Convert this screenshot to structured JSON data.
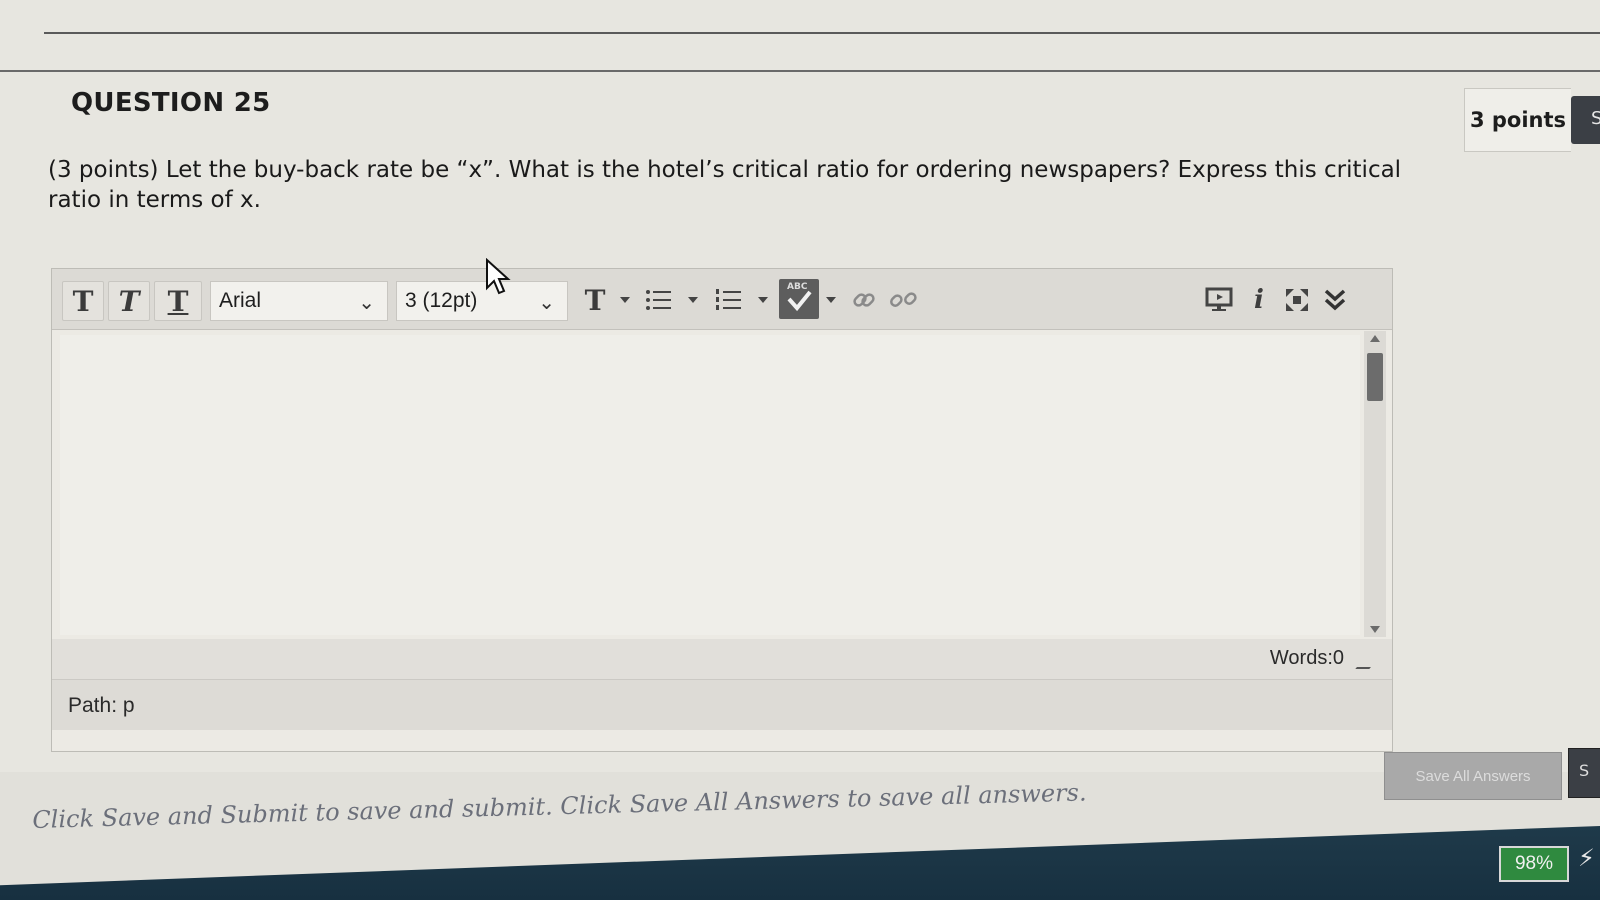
{
  "question": {
    "header": "QUESTION 25",
    "points": "3 points",
    "tab_label": "S",
    "text": "(3 points) Let the buy-back rate be “x”.  What is the hotel’s critical ratio for ordering newspapers?  Express this critical ratio in terms of x."
  },
  "editor": {
    "toolbar": {
      "bold_label": "T",
      "italic_label": "T",
      "underline_label": "T",
      "font_family": "Arial",
      "font_size": "3 (12pt)",
      "text_color_label": "T",
      "spellcheck_label": "ABC",
      "icons": [
        "bold-icon",
        "italic-icon",
        "underline-icon",
        "text-color-icon",
        "bullet-list-icon",
        "numbered-list-icon",
        "spellcheck-icon",
        "link-icon",
        "unlink-icon",
        "preview-icon",
        "info-icon",
        "fullscreen-icon",
        "expand-toolbar-icon"
      ]
    },
    "word_count": "Words:0",
    "path": "Path: p"
  },
  "footer": {
    "instructions": "Click Save and Submit to save and submit. Click Save All Answers to save all answers.",
    "save_all_label": "Save All Answers",
    "save_submit_label": "S"
  },
  "system": {
    "battery": "98%"
  }
}
